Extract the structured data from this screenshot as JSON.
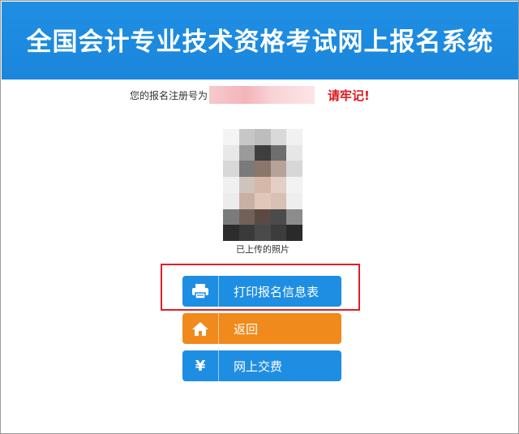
{
  "header": {
    "title": "全国会计专业技术资格考试网上报名系统"
  },
  "registration": {
    "prefix": "您的报名注册号为",
    "warning": "请牢记!"
  },
  "photo": {
    "caption": "已上传的照片",
    "pixel_colors": [
      "#f4f4f4",
      "#c7c7c7",
      "#bdbdbd",
      "#d9d9d9",
      "#f1f1f1",
      "#e8e8e8",
      "#9a9a9a",
      "#3e3e3e",
      "#6e6e6e",
      "#e6e6e6",
      "#d8d8d8",
      "#7a7a7a",
      "#8b766a",
      "#b7a29a",
      "#d7d7d7",
      "#f0f0f0",
      "#cfc3bc",
      "#d6b7a9",
      "#e4cfc7",
      "#f2f2f2",
      "#ececec",
      "#c9b0a4",
      "#e1c6ba",
      "#d9c0b4",
      "#eeeeee",
      "#7b7b7b",
      "#726159",
      "#5a4a43",
      "#4b4b4b",
      "#8c8c8c",
      "#2d2d2d",
      "#3a3a3a",
      "#4a4a4a",
      "#3c3c3c",
      "#2a2a2a"
    ]
  },
  "buttons": {
    "print": {
      "icon": "printer-icon",
      "label": "打印报名信息表"
    },
    "back": {
      "icon": "home-icon",
      "label": "返回"
    },
    "pay": {
      "icon": "yen-icon",
      "icon_glyph": "¥",
      "label": "网上交费"
    }
  },
  "colors": {
    "header_blue": "#1e8ee3",
    "button_orange": "#f08a1c",
    "warning_red": "#e0181f"
  }
}
